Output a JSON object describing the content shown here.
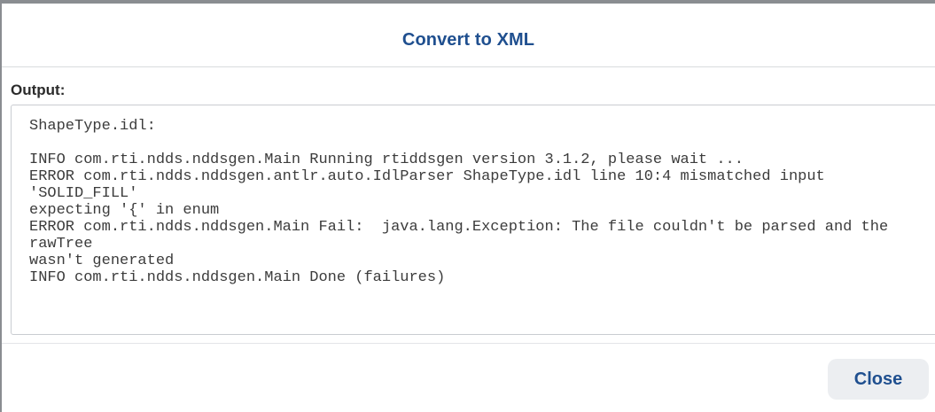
{
  "dialog": {
    "title": "Convert to XML",
    "output_label": "Output:",
    "output_lines": [
      "ShapeType.idl:",
      "",
      "INFO com.rti.ndds.nddsgen.Main Running rtiddsgen version 3.1.2, please wait ...",
      "ERROR com.rti.ndds.nddsgen.antlr.auto.IdlParser ShapeType.idl line 10:4 mismatched input 'SOLID_FILL'",
      "expecting '{' in enum",
      "ERROR com.rti.ndds.nddsgen.Main Fail:  java.lang.Exception: The file couldn't be parsed and the rawTree",
      "wasn't generated",
      "INFO com.rti.ndds.nddsgen.Main Done (failures)"
    ],
    "close_label": "Close"
  },
  "colors": {
    "accent": "#1f4f8f",
    "button_bg": "#eceef1",
    "text": "#3c3c3c"
  }
}
